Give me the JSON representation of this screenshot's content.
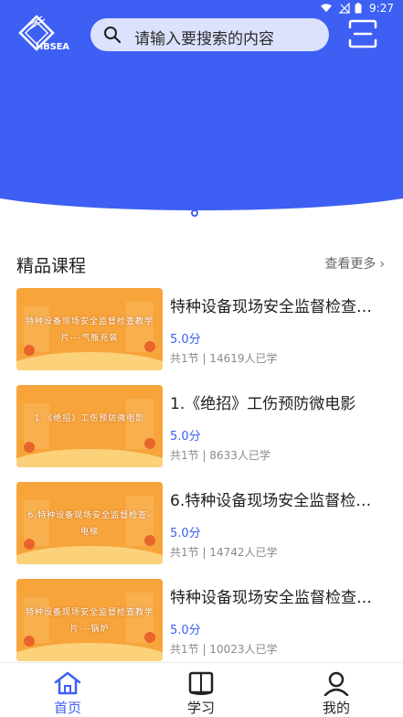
{
  "status_bar": {
    "time": "9:27"
  },
  "header": {
    "logo_text": "HBSEA",
    "search_placeholder": "请输入要搜索的内容",
    "scan_icon": "scan-icon"
  },
  "section": {
    "title": "精品课程",
    "more_label": "查看更多",
    "more_chevron": "›"
  },
  "courses": [
    {
      "title": "特种设备现场安全监督检查…",
      "thumb_text": "特种设备现场安全监督检查教学片---气瓶充装",
      "score": "5.0分",
      "meta": "共1节 | 14619人已学"
    },
    {
      "title": "1.《绝招》工伤预防微电影",
      "thumb_text": "1.《绝招》工伤预防微电影",
      "score": "5.0分",
      "meta": "共1节 | 8633人已学"
    },
    {
      "title": "6.特种设备现场安全监督检…",
      "thumb_text": "6.特种设备现场安全监督检查-电梯",
      "score": "5.0分",
      "meta": "共1节 | 14742人已学"
    },
    {
      "title": "特种设备现场安全监督检查…",
      "thumb_text": "特种设备现场安全监督检查教学片---锅炉",
      "score": "5.0分",
      "meta": "共1节 | 10023人已学"
    }
  ],
  "tabs": [
    {
      "label": "首页",
      "icon": "home-icon",
      "active": true
    },
    {
      "label": "学习",
      "icon": "book-icon",
      "active": false
    },
    {
      "label": "我的",
      "icon": "user-icon",
      "active": false
    }
  ],
  "colors": {
    "accent": "#3d5ff3",
    "thumb": "#f7a43a"
  }
}
